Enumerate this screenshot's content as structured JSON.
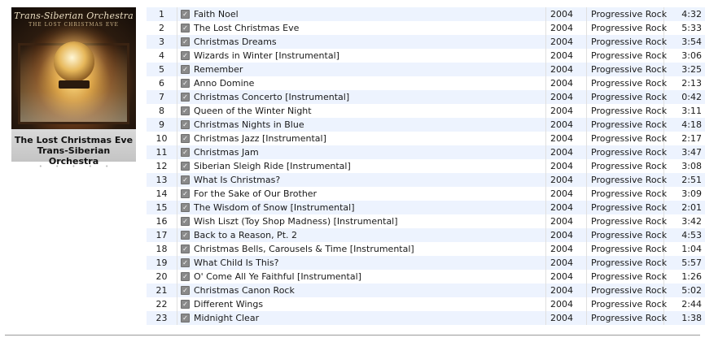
{
  "album": {
    "title": "The Lost Christmas Eve",
    "artist": "Trans-Siberian Orchestra",
    "art_band_text": "Trans-Siberian Orchestra",
    "art_album_text": "THE LOST CHRISTMAS EVE",
    "rating_stars": 0,
    "rating_dots": "• • • • •"
  },
  "checkmark_glyph": "✓",
  "tracks": [
    {
      "num": "1",
      "name": "Faith Noel",
      "year": "2004",
      "genre": "Progressive Rock",
      "time": "4:32"
    },
    {
      "num": "2",
      "name": "The Lost Christmas Eve",
      "year": "2004",
      "genre": "Progressive Rock",
      "time": "5:33"
    },
    {
      "num": "3",
      "name": "Christmas Dreams",
      "year": "2004",
      "genre": "Progressive Rock",
      "time": "3:54"
    },
    {
      "num": "4",
      "name": "Wizards in Winter [Instrumental]",
      "year": "2004",
      "genre": "Progressive Rock",
      "time": "3:06"
    },
    {
      "num": "5",
      "name": "Remember",
      "year": "2004",
      "genre": "Progressive Rock",
      "time": "3:25"
    },
    {
      "num": "6",
      "name": "Anno Domine",
      "year": "2004",
      "genre": "Progressive Rock",
      "time": "2:13"
    },
    {
      "num": "7",
      "name": "Christmas Concerto [Instrumental]",
      "year": "2004",
      "genre": "Progressive Rock",
      "time": "0:42"
    },
    {
      "num": "8",
      "name": "Queen of the Winter Night",
      "year": "2004",
      "genre": "Progressive Rock",
      "time": "3:11"
    },
    {
      "num": "9",
      "name": "Christmas Nights in Blue",
      "year": "2004",
      "genre": "Progressive Rock",
      "time": "4:18"
    },
    {
      "num": "10",
      "name": "Christmas Jazz [Instrumental]",
      "year": "2004",
      "genre": "Progressive Rock",
      "time": "2:17"
    },
    {
      "num": "11",
      "name": "Christmas Jam",
      "year": "2004",
      "genre": "Progressive Rock",
      "time": "3:47"
    },
    {
      "num": "12",
      "name": "Siberian Sleigh Ride [Instrumental]",
      "year": "2004",
      "genre": "Progressive Rock",
      "time": "3:08"
    },
    {
      "num": "13",
      "name": "What Is Christmas?",
      "year": "2004",
      "genre": "Progressive Rock",
      "time": "2:51"
    },
    {
      "num": "14",
      "name": "For the Sake of Our Brother",
      "year": "2004",
      "genre": "Progressive Rock",
      "time": "3:09"
    },
    {
      "num": "15",
      "name": "The Wisdom of Snow [Instrumental]",
      "year": "2004",
      "genre": "Progressive Rock",
      "time": "2:01"
    },
    {
      "num": "16",
      "name": "Wish Liszt (Toy Shop Madness) [Instrumental]",
      "year": "2004",
      "genre": "Progressive Rock",
      "time": "3:42"
    },
    {
      "num": "17",
      "name": "Back to a Reason, Pt. 2",
      "year": "2004",
      "genre": "Progressive Rock",
      "time": "4:53"
    },
    {
      "num": "18",
      "name": "Christmas Bells, Carousels & Time [Instrumental]",
      "year": "2004",
      "genre": "Progressive Rock",
      "time": "1:04"
    },
    {
      "num": "19",
      "name": "What Child Is This?",
      "year": "2004",
      "genre": "Progressive Rock",
      "time": "5:57"
    },
    {
      "num": "20",
      "name": "O' Come All Ye Faithful [Instrumental]",
      "year": "2004",
      "genre": "Progressive Rock",
      "time": "1:26"
    },
    {
      "num": "21",
      "name": "Christmas Canon Rock",
      "year": "2004",
      "genre": "Progressive Rock",
      "time": "5:02"
    },
    {
      "num": "22",
      "name": "Different Wings",
      "year": "2004",
      "genre": "Progressive Rock",
      "time": "2:44"
    },
    {
      "num": "23",
      "name": "Midnight Clear",
      "year": "2004",
      "genre": "Progressive Rock",
      "time": "1:38"
    }
  ],
  "colors": {
    "row_alt": "#edf3fe",
    "row_base": "#ffffff",
    "checkbox": "#8a8a8a"
  }
}
